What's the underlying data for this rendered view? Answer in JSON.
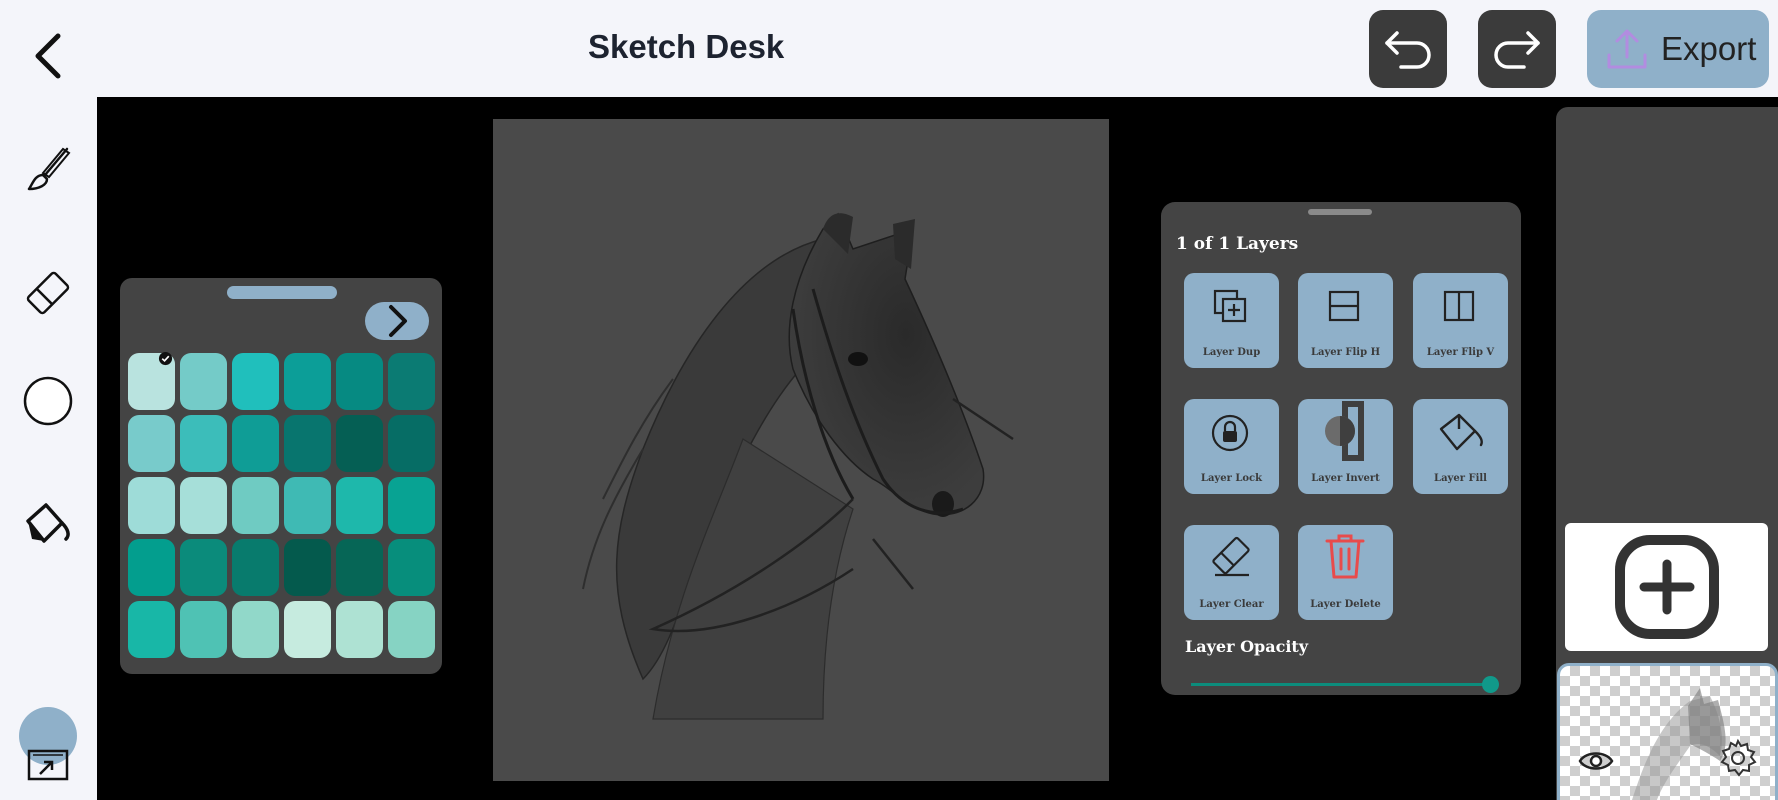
{
  "header": {
    "title": "Sketch Desk",
    "export_label": "Export",
    "icons": [
      "back-arrow-icon",
      "undo-icon",
      "redo-icon",
      "upload-icon"
    ]
  },
  "toolbar": {
    "tools": [
      "brush-icon",
      "eraser-icon",
      "shape-circle-icon",
      "fill-bucket-icon",
      "color-swatch",
      "fit-screen-icon"
    ],
    "current_color": "#8fb0c9"
  },
  "palette": {
    "selected_index": 0,
    "colors": [
      "#b9e3df",
      "#74cbc8",
      "#20bfbc",
      "#0c9e98",
      "#068a82",
      "#0b7b73",
      "#78cbcb",
      "#3cbdba",
      "#0f9d96",
      "#08756e",
      "#055f54",
      "#066d65",
      "#9edcd8",
      "#a6dfd9",
      "#6fcbc2",
      "#3fbab4",
      "#1eb8ab",
      "#08a393",
      "#039e8e",
      "#0b8b7b",
      "#087b6d",
      "#045a4d",
      "#066656",
      "#078e7c",
      "#18b7a7",
      "#4fc2b4",
      "#91d8c9",
      "#c6ebdf",
      "#aee2d3",
      "#86d3c3"
    ]
  },
  "layers": {
    "count_label": "1 of 1 Layers",
    "buttons": [
      {
        "label": "Layer Dup",
        "icon": "layer-duplicate-icon"
      },
      {
        "label": "Layer Flip H",
        "icon": "flip-horizontal-icon"
      },
      {
        "label": "Layer Flip V",
        "icon": "flip-vertical-icon"
      },
      {
        "label": "Layer Lock",
        "icon": "lock-icon"
      },
      {
        "label": "Layer Invert",
        "icon": "invert-icon"
      },
      {
        "label": "Layer Fill",
        "icon": "fill-bucket-icon"
      },
      {
        "label": "Layer Clear",
        "icon": "eraser-icon"
      },
      {
        "label": "Layer Delete",
        "icon": "trash-icon"
      }
    ],
    "opacity_label": "Layer Opacity",
    "opacity_value": 1.0,
    "delete_color": "#e84b4b",
    "accent_color": "#11998a"
  },
  "layer_strip": {
    "icons": [
      "add-layer-icon",
      "eye-icon",
      "gear-icon"
    ],
    "selected_border": "#8fb0c9"
  }
}
